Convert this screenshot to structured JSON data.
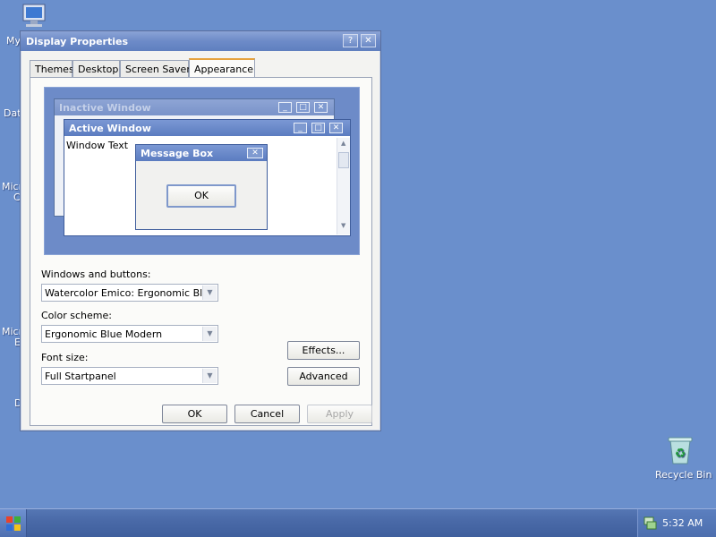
{
  "desktop": {
    "icons": [
      {
        "label": "My",
        "icon": "computer-icon"
      },
      {
        "label": "Dat",
        "icon": "folder-icon"
      },
      {
        "label": "Micr",
        "sub": "C",
        "icon": "app-icon"
      },
      {
        "label": "Micr",
        "sub": "E",
        "icon": "app-icon"
      },
      {
        "label": "D",
        "icon": "app-icon"
      }
    ],
    "recycle_bin": {
      "label": "Recycle Bin",
      "icon": "recycle-bin-icon"
    }
  },
  "dialog": {
    "title": "Display Properties",
    "help_btn": "?",
    "close_btn": "✕",
    "tabs": [
      "Themes",
      "Desktop",
      "Screen Saver",
      "Appearance"
    ],
    "active_tab": "Appearance",
    "preview": {
      "inactive_title": "Inactive Window",
      "active_title": "Active Window",
      "window_text": "Window Text",
      "message_box_title": "Message Box",
      "ok_label": "OK"
    },
    "windows_buttons": {
      "label": "Windows and buttons:",
      "value": "Watercolor Emico: Ergonomic Blue"
    },
    "color_scheme": {
      "label": "Color scheme:",
      "value": "Ergonomic Blue Modern"
    },
    "font_size": {
      "label": "Font size:",
      "value": "Full Startpanel"
    },
    "effects_label": "Effects...",
    "advanced_label": "Advanced",
    "ok_label": "OK",
    "cancel_label": "Cancel",
    "apply_label": "Apply"
  },
  "taskbar": {
    "clock": "5:32 AM",
    "start_icon": "start-icon",
    "tray_icon": "network-icon"
  },
  "colors": {
    "desktop": "#6a8fcc",
    "accent_tab": "#e6a23c"
  }
}
